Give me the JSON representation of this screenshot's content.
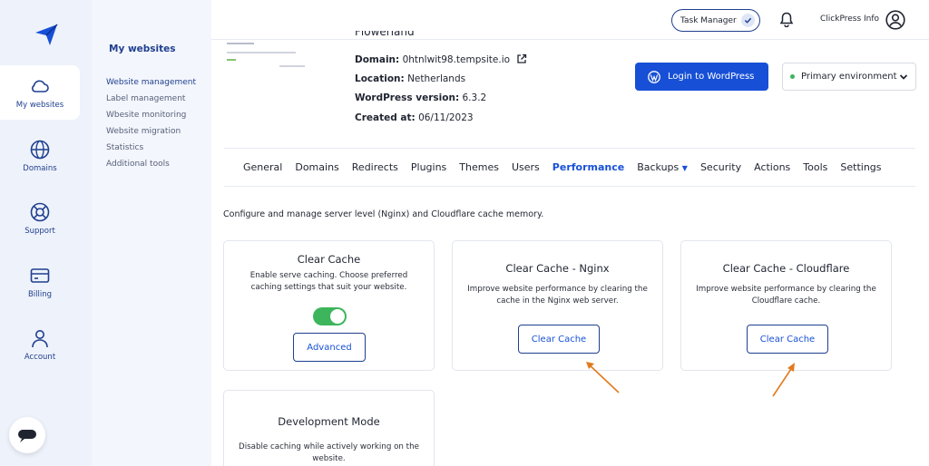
{
  "rail": {
    "items": [
      {
        "label": "My websites",
        "icon": "cloud-icon"
      },
      {
        "label": "Domains",
        "icon": "globe-icon"
      },
      {
        "label": "Support",
        "icon": "lifebuoy-icon"
      },
      {
        "label": "Billing",
        "icon": "card-icon"
      },
      {
        "label": "Account",
        "icon": "person-icon"
      }
    ]
  },
  "subnav": {
    "title": "My websites",
    "links": [
      "Website management",
      "Label management",
      "Wbesite monitoring",
      "Website migration",
      "Statistics",
      "Additional tools"
    ]
  },
  "topbar": {
    "task_manager": "Task Manager",
    "user": "ClickPress Info"
  },
  "site": {
    "name": "Flowerland",
    "domain_label": "Domain:",
    "domain": "0htnlwit98.tempsite.io",
    "location_label": "Location:",
    "location": "Netherlands",
    "wp_label": "WordPress version:",
    "wp_version": "6.3.2",
    "created_label": "Created at:",
    "created": "06/11/2023"
  },
  "actions": {
    "login": "Login to WordPress",
    "environment": "Primary environment"
  },
  "tabs": [
    "General",
    "Domains",
    "Redirects",
    "Plugins",
    "Themes",
    "Users",
    "Performance",
    "Backups",
    "Security",
    "Actions",
    "Tools",
    "Settings"
  ],
  "active_tab": "Performance",
  "description": "Configure and manage server level (Nginx) and Cloudflare cache memory.",
  "cards": {
    "clear_cache": {
      "title": "Clear Cache",
      "text": "Enable serve caching. Choose preferred caching settings that suit your website.",
      "button": "Advanced",
      "toggle_on": true
    },
    "nginx": {
      "title": "Clear Cache - Nginx",
      "text": "Improve website performance by clearing the cache in the Nginx web server.",
      "button": "Clear Cache"
    },
    "cloudflare": {
      "title": "Clear Cache - Cloudflare",
      "text": "Improve website performance by clearing the Cloudflare cache.",
      "button": "Clear Cache"
    },
    "dev_mode": {
      "title": "Development Mode",
      "text": "Disable caching while actively working on the website."
    }
  },
  "colors": {
    "accent": "#1750d6",
    "navy": "#1f3f8f",
    "green": "#3db55c",
    "annotation": "#e07b1f"
  }
}
